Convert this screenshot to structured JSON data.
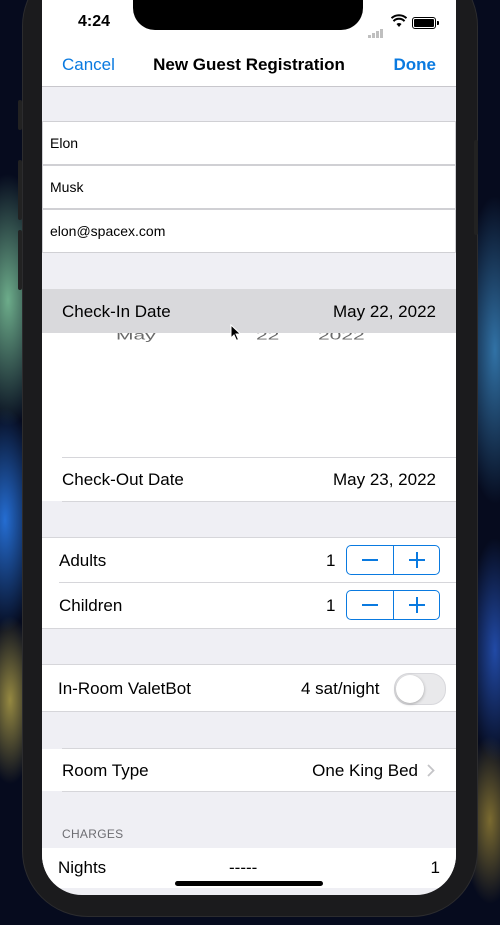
{
  "status_bar": {
    "time": "4:24"
  },
  "nav": {
    "cancel_label": "Cancel",
    "title": "New Guest Registration",
    "done_label": "Done"
  },
  "guest": {
    "first_name": "Elon",
    "last_name": "Musk",
    "email": "elon@spacex.com"
  },
  "check_in": {
    "label": "Check-In Date",
    "value": "May 22, 2022"
  },
  "date_picker": {
    "month": "May",
    "day": "22",
    "year": "2022"
  },
  "check_out": {
    "label": "Check-Out Date",
    "value": "May 23, 2022"
  },
  "adults": {
    "label": "Adults",
    "value": "1"
  },
  "children": {
    "label": "Children",
    "value": "1"
  },
  "valetbot": {
    "label": "In-Room ValetBot",
    "price": "4 sat/night",
    "enabled": false
  },
  "room_type": {
    "label": "Room Type",
    "value": "One King Bed"
  },
  "charges": {
    "header": "CHARGES",
    "nights": {
      "label": "Nights",
      "detail": "-----",
      "value": "1"
    }
  },
  "icons": [
    "signal-icon",
    "wifi-icon",
    "battery-icon",
    "chevron-right-icon",
    "minus-icon",
    "plus-icon",
    "cursor-icon"
  ],
  "colors": {
    "accent": "#0a7ae0",
    "grouped_background": "#efeff4",
    "highlight_row": "#d9d9dc"
  }
}
